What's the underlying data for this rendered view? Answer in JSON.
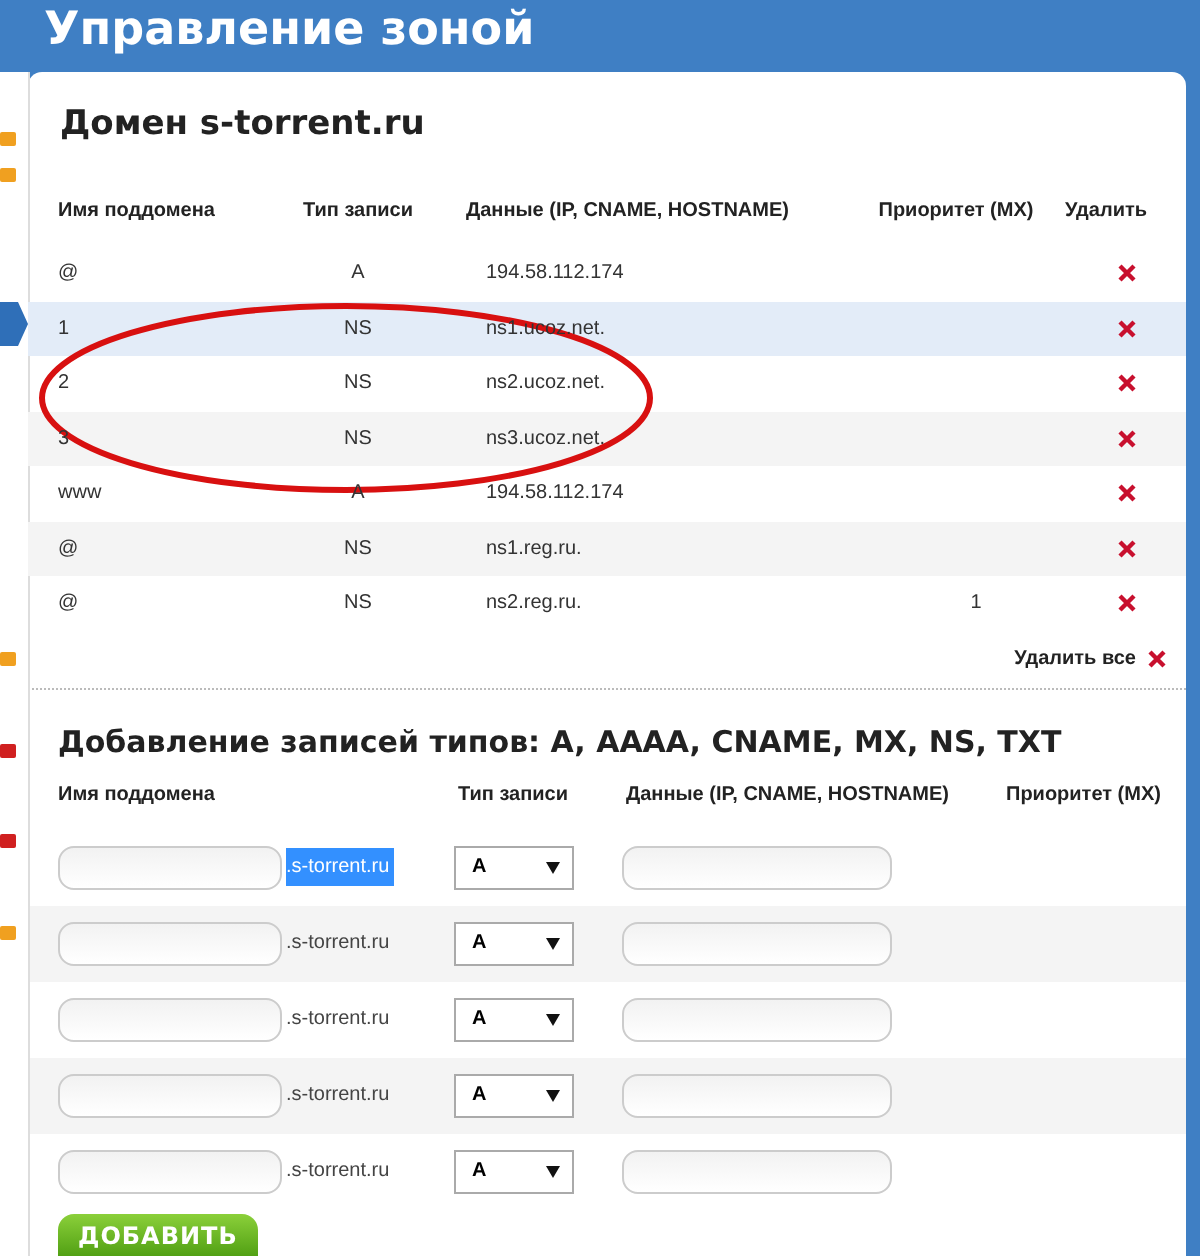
{
  "page_title": "Управление зоной",
  "domain": {
    "title": "Домен s-torrent.ru",
    "columns": [
      "Имя поддомена",
      "Тип записи",
      "Данные (IP, CNAME, HOSTNAME)",
      "Приоритет (MX)",
      "Удалить"
    ],
    "rows": [
      {
        "name": "@",
        "type": "A",
        "data": "194.58.112.174",
        "selected": false
      },
      {
        "name": "1",
        "type": "NS",
        "data": "ns1.ucoz.net.",
        "selected": true
      },
      {
        "name": "2",
        "type": "NS",
        "data": "ns2.ucoz.net.",
        "selected": false
      },
      {
        "name": "3",
        "type": "NS",
        "data": "ns3.ucoz.net.",
        "selected": false
      },
      {
        "name": "www",
        "type": "A",
        "data": "194.58.112.174",
        "selected": false
      },
      {
        "name": "@",
        "type": "NS",
        "data": "ns1.reg.ru.",
        "selected": false
      },
      {
        "name": "@",
        "type": "NS",
        "data": "ns2.reg.ru.",
        "priority": "1",
        "selected": false
      }
    ],
    "delete_all": "Удалить все"
  },
  "add": {
    "title": "Добавление записей типов: A, AAAA, CNAME, MX, NS, TXT",
    "columns": [
      "Имя поддомена",
      "Тип записи",
      "Данные (IP, CNAME, HOSTNAME)",
      "Приоритет (MX)"
    ],
    "rows": [
      {
        "suffix": ".s-torrent.ru",
        "suffix_selected": true,
        "type": "A"
      },
      {
        "suffix": ".s-torrent.ru",
        "suffix_selected": false,
        "type": "A"
      },
      {
        "suffix": ".s-torrent.ru",
        "suffix_selected": false,
        "type": "A"
      },
      {
        "suffix": ".s-torrent.ru",
        "suffix_selected": false,
        "type": "A"
      },
      {
        "suffix": ".s-torrent.ru",
        "suffix_selected": false,
        "type": "A"
      }
    ],
    "button": "ДОБАВИТЬ"
  }
}
